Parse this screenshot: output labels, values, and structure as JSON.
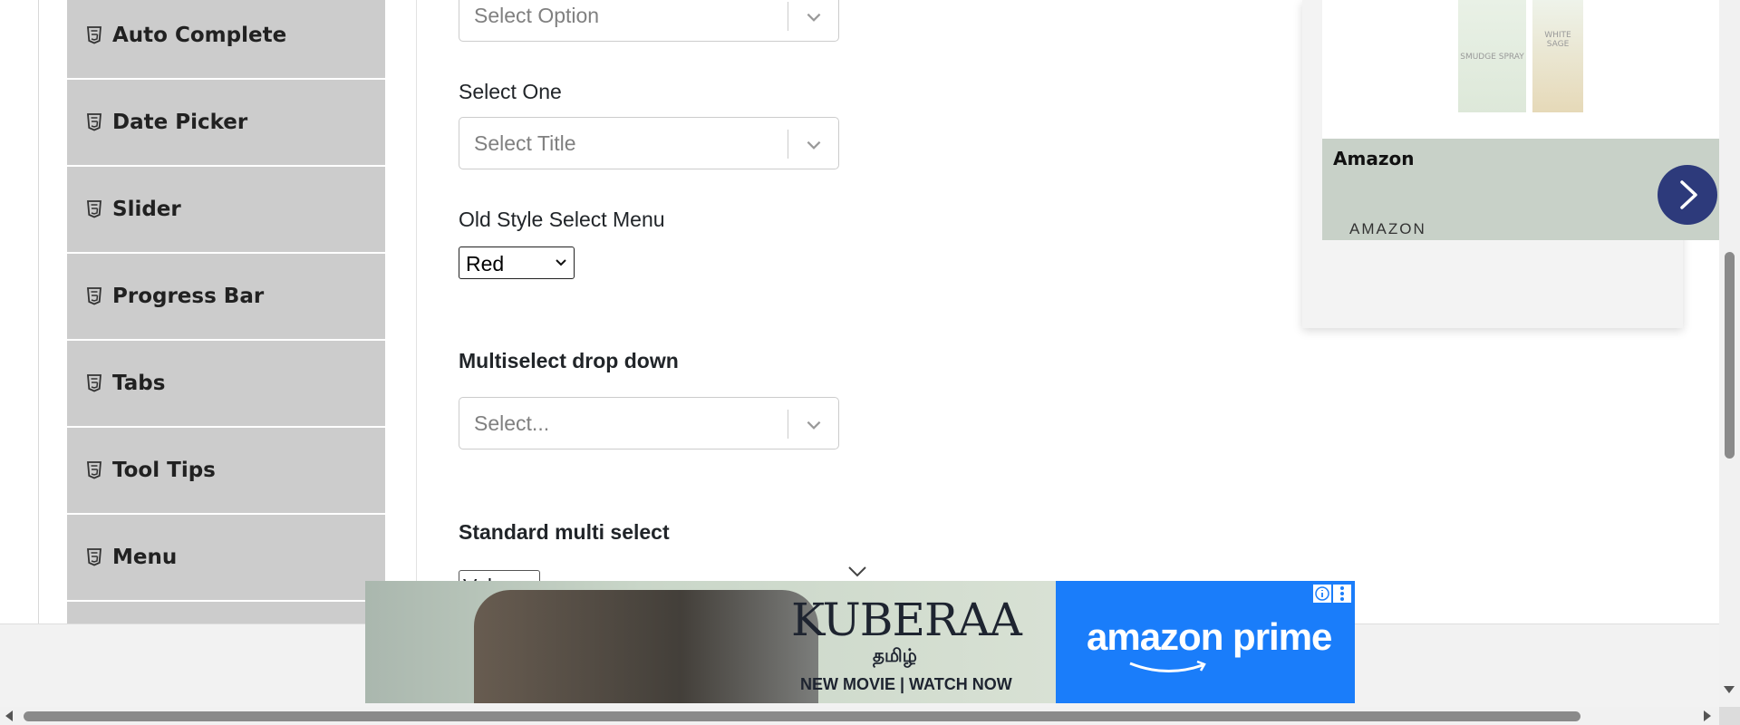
{
  "sidebar": {
    "items": [
      {
        "label": "Auto Complete",
        "icon": "html5-icon"
      },
      {
        "label": "Date Picker",
        "icon": "html5-icon"
      },
      {
        "label": "Slider",
        "icon": "html5-icon"
      },
      {
        "label": "Progress Bar",
        "icon": "html5-icon"
      },
      {
        "label": "Tabs",
        "icon": "html5-icon"
      },
      {
        "label": "Tool Tips",
        "icon": "html5-icon"
      },
      {
        "label": "Menu",
        "icon": "html5-icon"
      }
    ]
  },
  "form": {
    "select_value": {
      "placeholder": "Select Option"
    },
    "select_one": {
      "label": "Select One",
      "placeholder": "Select Title"
    },
    "old_style": {
      "label": "Old Style Select Menu",
      "value": "Red"
    },
    "multiselect": {
      "label": "Multiselect drop down",
      "placeholder": "Select..."
    },
    "standard_multi": {
      "label": "Standard multi select",
      "partial_value": "Vol"
    }
  },
  "ad_card": {
    "product_text_1": "SMUDGE SPRAY",
    "product_text_2": "WHITE SAGE",
    "title": "Amazon",
    "brand": "AMAZON"
  },
  "banner": {
    "movie_title": "KUBERAA",
    "language": "தமிழ்",
    "cta": "NEW MOVIE | WATCH NOW",
    "service": "amazon prime"
  },
  "colors": {
    "sidebar_bg": "#cccccc",
    "ad_button": "#2d3a7b",
    "prime_blue": "#1a7dfa"
  }
}
